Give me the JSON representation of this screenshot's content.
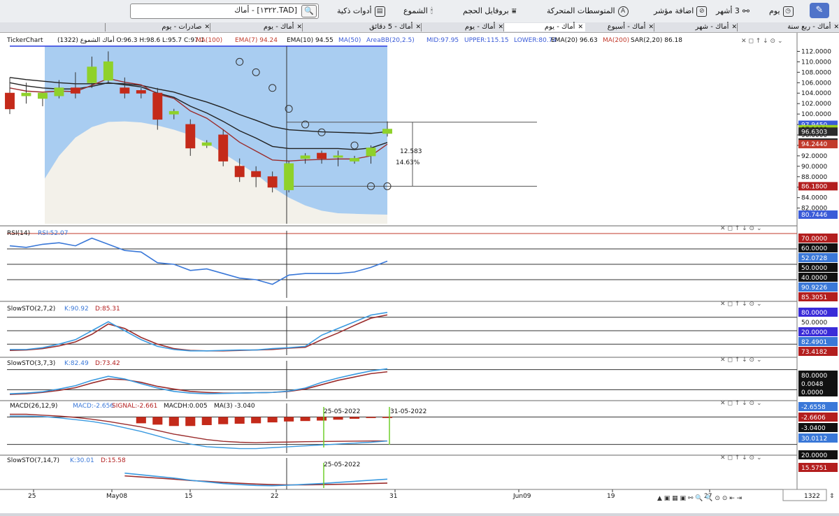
{
  "toolbar": {
    "interval_label": "يوم",
    "range_label": "3 أشهر",
    "add_indicator_label": "اضافة مؤشر",
    "moving_averages_label": "المتوسطات المتحركة",
    "volume_profile_label": "بروفايل الحجم",
    "candles_label": "الشموع",
    "smart_tools_label": "أدوات ذكية",
    "search_value": "[TAD.١٣٢٢] - أماك",
    "exports_tab": "صادرات - يوم"
  },
  "tabs": [
    {
      "label": "أماك - ربع سنة"
    },
    {
      "label": "أماك - شهر"
    },
    {
      "label": "أماك - أسبوع"
    },
    {
      "label": "أماك - يوم",
      "active": true
    },
    {
      "label": "أماك - يوم"
    },
    {
      "label": "أماك - 5 دقائق"
    },
    {
      "label": "أماك - يوم"
    },
    {
      "label": "صادرات - يوم"
    }
  ],
  "main_header": {
    "brand": "TickerChart",
    "info": "أماك الشموع (1322) O:96.3 H:98.6 L:95.7 C:97.1",
    "ma100": "MA(100)",
    "ema7": "EMA(7) 94.24",
    "ema10": "EMA(10) 94.55",
    "ma50": "MA(50)",
    "areabb": "AreaBB(20,2.5)",
    "mid": "MID:97.95",
    "upper": "UPPER:115.15",
    "lower": "LOWER:80.74",
    "ema20": "EMA(20) 96.63",
    "ma200": "MA(200)",
    "sar": "SAR(2,20) 86.18"
  },
  "price_axis": {
    "ticks": [
      "112.0000",
      "110.0000",
      "108.0000",
      "106.0000",
      "104.0000",
      "102.0000",
      "100.0000",
      "98.0000",
      "96.0000",
      "94.0000",
      "92.0000",
      "90.0000",
      "88.0000",
      "86.0000",
      "84.0000",
      "82.0000"
    ],
    "badges": [
      {
        "text": "97.9450",
        "color": "#3a5bd8"
      },
      {
        "text": "97.1000",
        "color": "#9ed11f",
        "dark": true
      },
      {
        "text": "96.6303",
        "color": "#2b2b2b"
      },
      {
        "text": "94.5482",
        "color": "#2b2b2b"
      },
      {
        "text": "94.2440",
        "color": "#c23a2b"
      },
      {
        "text": "86.1800",
        "color": "#b31e1e"
      },
      {
        "text": "80.7446",
        "color": "#3a5bd8"
      }
    ]
  },
  "measure": {
    "value": "12.583",
    "percent": "14.63%"
  },
  "chart_data": [
    {
      "type": "candlestick",
      "title": "أماك الشموع (1322)",
      "ylim": [
        79,
        113
      ],
      "candles": [
        {
          "o": 104,
          "h": 107,
          "l": 100,
          "c": 101
        },
        {
          "o": 103.5,
          "h": 106,
          "l": 102,
          "c": 104
        },
        {
          "o": 103,
          "h": 104,
          "l": 101.5,
          "c": 104
        },
        {
          "o": 103.5,
          "h": 106.5,
          "l": 103,
          "c": 105
        },
        {
          "o": 105,
          "h": 108,
          "l": 103,
          "c": 104
        },
        {
          "o": 106,
          "h": 111,
          "l": 105,
          "c": 109
        },
        {
          "o": 106.5,
          "h": 112,
          "l": 106,
          "c": 110
        },
        {
          "o": 105,
          "h": 107,
          "l": 103,
          "c": 104
        },
        {
          "o": 104.5,
          "h": 105,
          "l": 103,
          "c": 104
        },
        {
          "o": 104,
          "h": 105,
          "l": 97,
          "c": 99
        },
        {
          "o": 100,
          "h": 101,
          "l": 99,
          "c": 100.5
        },
        {
          "o": 98,
          "h": 99,
          "l": 92,
          "c": 93.5
        },
        {
          "o": 94,
          "h": 95,
          "l": 93.5,
          "c": 94.5
        },
        {
          "o": 96,
          "h": 97,
          "l": 90,
          "c": 91
        },
        {
          "o": 90,
          "h": 91.5,
          "l": 87,
          "c": 88
        },
        {
          "o": 89,
          "h": 90,
          "l": 86,
          "c": 88
        },
        {
          "o": 88,
          "h": 89,
          "l": 85,
          "c": 86
        },
        {
          "o": 85.5,
          "h": 91,
          "l": 85,
          "c": 90.5
        },
        {
          "o": 91.5,
          "h": 92.5,
          "l": 90.5,
          "c": 92
        },
        {
          "o": 92.5,
          "h": 93,
          "l": 90.5,
          "c": 91.5
        },
        {
          "o": 92,
          "h": 93,
          "l": 90,
          "c": 92
        },
        {
          "o": 91,
          "h": 92,
          "l": 90.5,
          "c": 91.5
        },
        {
          "o": 92,
          "h": 94,
          "l": 90.5,
          "c": 93.5
        },
        {
          "o": 96.3,
          "h": 98.6,
          "l": 95.7,
          "c": 97.1
        }
      ],
      "bb_upper": [
        114,
        114.2,
        114.8,
        115.4,
        116,
        116.4,
        116.6,
        116.5,
        116.2,
        115.9,
        115.7,
        115.5,
        115.4,
        115.3,
        115.3,
        115.2,
        115.2,
        115.2,
        115.2,
        115.2,
        115.15,
        115.15,
        115.15,
        115.15
      ],
      "bb_lower": [
        79,
        82,
        87,
        92,
        95.5,
        97.5,
        98.5,
        98.6,
        98.4,
        97.8,
        97,
        96,
        94.5,
        92.5,
        90.5,
        88.5,
        86,
        84,
        82.5,
        81.5,
        81,
        80.9,
        80.8,
        80.74
      ],
      "ema20": [
        107,
        106.6,
        106.3,
        106,
        105.8,
        105.8,
        105.9,
        105.8,
        105.5,
        104.8,
        104.2,
        103.2,
        102.3,
        101.2,
        99.9,
        98.8,
        97.6,
        97,
        96.8,
        96.6,
        96.5,
        96.4,
        96.3,
        96.63
      ],
      "ema10": [
        106,
        105.4,
        105,
        104.8,
        104.8,
        105.3,
        106,
        105.6,
        105.2,
        104,
        103.2,
        101.5,
        100.2,
        98.6,
        96.8,
        95.4,
        93.8,
        93.4,
        93.4,
        93.4,
        93.4,
        93.2,
        93.5,
        94.55
      ],
      "ema7": [
        105,
        104.4,
        104.2,
        104.4,
        104.3,
        105.5,
        106.8,
        106.1,
        105.6,
        103.8,
        103,
        100.6,
        99.2,
        97,
        94.6,
        92.9,
        91.2,
        91,
        91.2,
        91.3,
        91.4,
        91.4,
        92,
        94.24
      ],
      "sar": [
        null,
        null,
        null,
        null,
        null,
        null,
        null,
        null,
        null,
        null,
        null,
        null,
        null,
        null,
        110,
        108,
        105,
        101,
        98,
        96.5,
        null,
        94,
        86.18,
        86.18
      ],
      "xlabels": [
        "25",
        "May08",
        "15",
        "22",
        "31",
        "Jun09",
        "19",
        "27"
      ]
    },
    {
      "type": "line",
      "title": "RSI(14)",
      "value_label": "RSI:52.07",
      "ylim": [
        30,
        70
      ],
      "series": [
        {
          "name": "RSI",
          "values": [
            62,
            61,
            63,
            64,
            62,
            67,
            63,
            59,
            58,
            51,
            50,
            46,
            47,
            44,
            41,
            40,
            37,
            43,
            44,
            44,
            44,
            45,
            48,
            52.07
          ]
        }
      ],
      "levels": [
        70,
        60,
        50,
        40
      ]
    },
    {
      "type": "line",
      "title": "SlowSTO(2,7,2)",
      "k_label": "K:90.92",
      "d_label": "D:85.31",
      "ylim": [
        0,
        100
      ],
      "series": [
        {
          "name": "K",
          "values": [
            8,
            8,
            12,
            20,
            30,
            50,
            70,
            50,
            30,
            15,
            8,
            5,
            5,
            6,
            7,
            7,
            10,
            12,
            15,
            40,
            55,
            70,
            85,
            90.92
          ]
        },
        {
          "name": "D",
          "values": [
            6,
            7,
            10,
            16,
            25,
            42,
            65,
            55,
            35,
            20,
            10,
            6,
            5,
            5,
            6,
            7,
            8,
            11,
            13,
            30,
            45,
            62,
            78,
            85.31
          ]
        }
      ],
      "levels": [
        80,
        50,
        20
      ]
    },
    {
      "type": "line",
      "title": "SlowSTO(3,7,3)",
      "k_label": "K:82.49",
      "d_label": "D:73.42",
      "ylim": [
        0,
        100
      ],
      "series": [
        {
          "name": "K",
          "values": [
            8,
            10,
            14,
            22,
            32,
            48,
            60,
            52,
            38,
            25,
            15,
            10,
            8,
            9,
            10,
            11,
            12,
            16,
            25,
            42,
            55,
            66,
            76,
            82.49
          ]
        },
        {
          "name": "D",
          "values": [
            6,
            8,
            12,
            18,
            26,
            40,
            52,
            50,
            42,
            30,
            22,
            15,
            12,
            10,
            10,
            11,
            12,
            15,
            22,
            35,
            48,
            58,
            68,
            73.42
          ]
        }
      ],
      "levels": [
        80,
        20
      ]
    },
    {
      "type": "macd",
      "title": "MACD(26,12,9)",
      "macd_label": "MACD:-2.656",
      "signal_label": "SIGNAL:-2.661",
      "hist_label": "MACDH:0.005",
      "ma_label": "MA(3) -3.040",
      "ylim": [
        -4,
        1.5
      ],
      "macd": [
        0.1,
        0.1,
        0.05,
        -0.1,
        -0.3,
        -0.5,
        -0.8,
        -1.2,
        -1.6,
        -2.1,
        -2.6,
        -3.0,
        -3.3,
        -3.4,
        -3.5,
        -3.5,
        -3.4,
        -3.3,
        -3.2,
        -3.1,
        -3.0,
        -2.9,
        -2.8,
        -2.656
      ],
      "signal": [
        0.3,
        0.3,
        0.2,
        0.1,
        -0.05,
        -0.25,
        -0.5,
        -0.8,
        -1.1,
        -1.5,
        -1.9,
        -2.2,
        -2.5,
        -2.7,
        -2.8,
        -2.85,
        -2.8,
        -2.78,
        -2.74,
        -2.72,
        -2.7,
        -2.68,
        -2.66,
        -2.661
      ],
      "hist": [
        0.0,
        0.0,
        -0.1,
        -0.15,
        -0.2,
        -0.3,
        -0.4,
        -0.55,
        -0.7,
        -0.85,
        -1.0,
        -1.0,
        -0.9,
        -0.8,
        -0.75,
        -0.7,
        -0.6,
        -0.5,
        -0.45,
        -0.4,
        -0.3,
        -0.2,
        -0.1,
        0.005
      ],
      "annotations": [
        "25-05-2022",
        "31-05-2022"
      ]
    },
    {
      "type": "line",
      "title": "SlowSTO(7,14,7)",
      "k_label": "K:30.01",
      "d_label": "D:15.58",
      "ylim": [
        0,
        100
      ],
      "series": [
        {
          "name": "K",
          "values": [
            62,
            62,
            62,
            61,
            60,
            58,
            56,
            52,
            46,
            40,
            34,
            26,
            20,
            14,
            10,
            7,
            6,
            8,
            11,
            14,
            18,
            22,
            26,
            30.01
          ]
        },
        {
          "name": "D",
          "values": [
            45,
            46,
            47,
            47,
            47,
            46,
            45,
            42,
            38,
            34,
            30,
            25,
            22,
            18,
            15,
            12,
            10,
            9,
            9,
            10,
            11,
            12,
            14,
            15.58
          ]
        }
      ],
      "annotation": "25-05-2022"
    }
  ],
  "indicator_axes": {
    "rsi": [
      {
        "text": "70.0000",
        "bg": "#b31e1e"
      },
      {
        "text": "60.0000",
        "bg": "#111"
      },
      {
        "text": "52.0728",
        "bg": "#3a78d8"
      },
      {
        "text": "50.0000",
        "bg": "#111"
      },
      {
        "text": "40.0000",
        "bg": "#111"
      },
      {
        "text": "90.9226",
        "bg": "#3a78d8"
      },
      {
        "text": "85.3051",
        "bg": "#b31e1e"
      }
    ],
    "sto1": [
      {
        "text": "80.0000",
        "bg": "#3a2bd8"
      },
      {
        "text": "50.0000",
        "bg": "none"
      },
      {
        "text": "20.0000",
        "bg": "#3a2bd8"
      },
      {
        "text": "82.4901",
        "bg": "#3a78d8"
      },
      {
        "text": "73.4182",
        "bg": "#b31e1e"
      }
    ],
    "sto2": [
      {
        "text": "80.0000",
        "bg": "#111"
      },
      {
        "text": "0.0048",
        "bg": "#111"
      },
      {
        "text": "0.0000",
        "bg": "#111"
      }
    ],
    "macd": [
      {
        "text": "-2.6558",
        "bg": "#3a78d8"
      },
      {
        "text": "-2.6606",
        "bg": "#b31e1e"
      },
      {
        "text": "-3.0400",
        "bg": "#111"
      },
      {
        "text": "30.0112",
        "bg": "#3a78d8"
      }
    ],
    "sto3": [
      {
        "text": "20.0000",
        "bg": "#111"
      },
      {
        "text": "15.5751",
        "bg": "#b31e1e"
      }
    ]
  },
  "zoom_value": "1322"
}
